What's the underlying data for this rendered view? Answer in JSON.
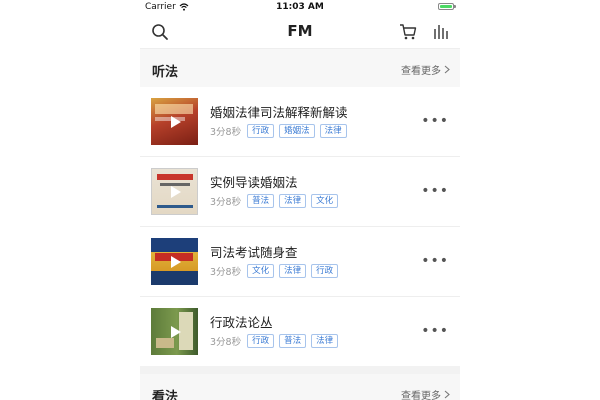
{
  "status": {
    "carrier": "Carrier",
    "time": "11:03 AM"
  },
  "nav": {
    "title": "FM"
  },
  "sections": [
    {
      "title": "听法",
      "more": "查看更多",
      "items": [
        {
          "title": "婚姻法律司法解释新解读",
          "duration": "3分8秒",
          "tags": [
            "行政",
            "婚姻法",
            "法律"
          ]
        },
        {
          "title": "实例导读婚姻法",
          "duration": "3分8秒",
          "tags": [
            "普法",
            "法律",
            "文化"
          ]
        },
        {
          "title": "司法考试随身查",
          "duration": "3分8秒",
          "tags": [
            "文化",
            "法律",
            "行政"
          ]
        },
        {
          "title": "行政法论丛",
          "duration": "3分8秒",
          "tags": [
            "行政",
            "普法",
            "法律"
          ]
        }
      ]
    },
    {
      "title": "看法",
      "more": "查看更多"
    }
  ],
  "colors": {
    "accent": "#3b7bd4",
    "battery": "#4cd964"
  }
}
